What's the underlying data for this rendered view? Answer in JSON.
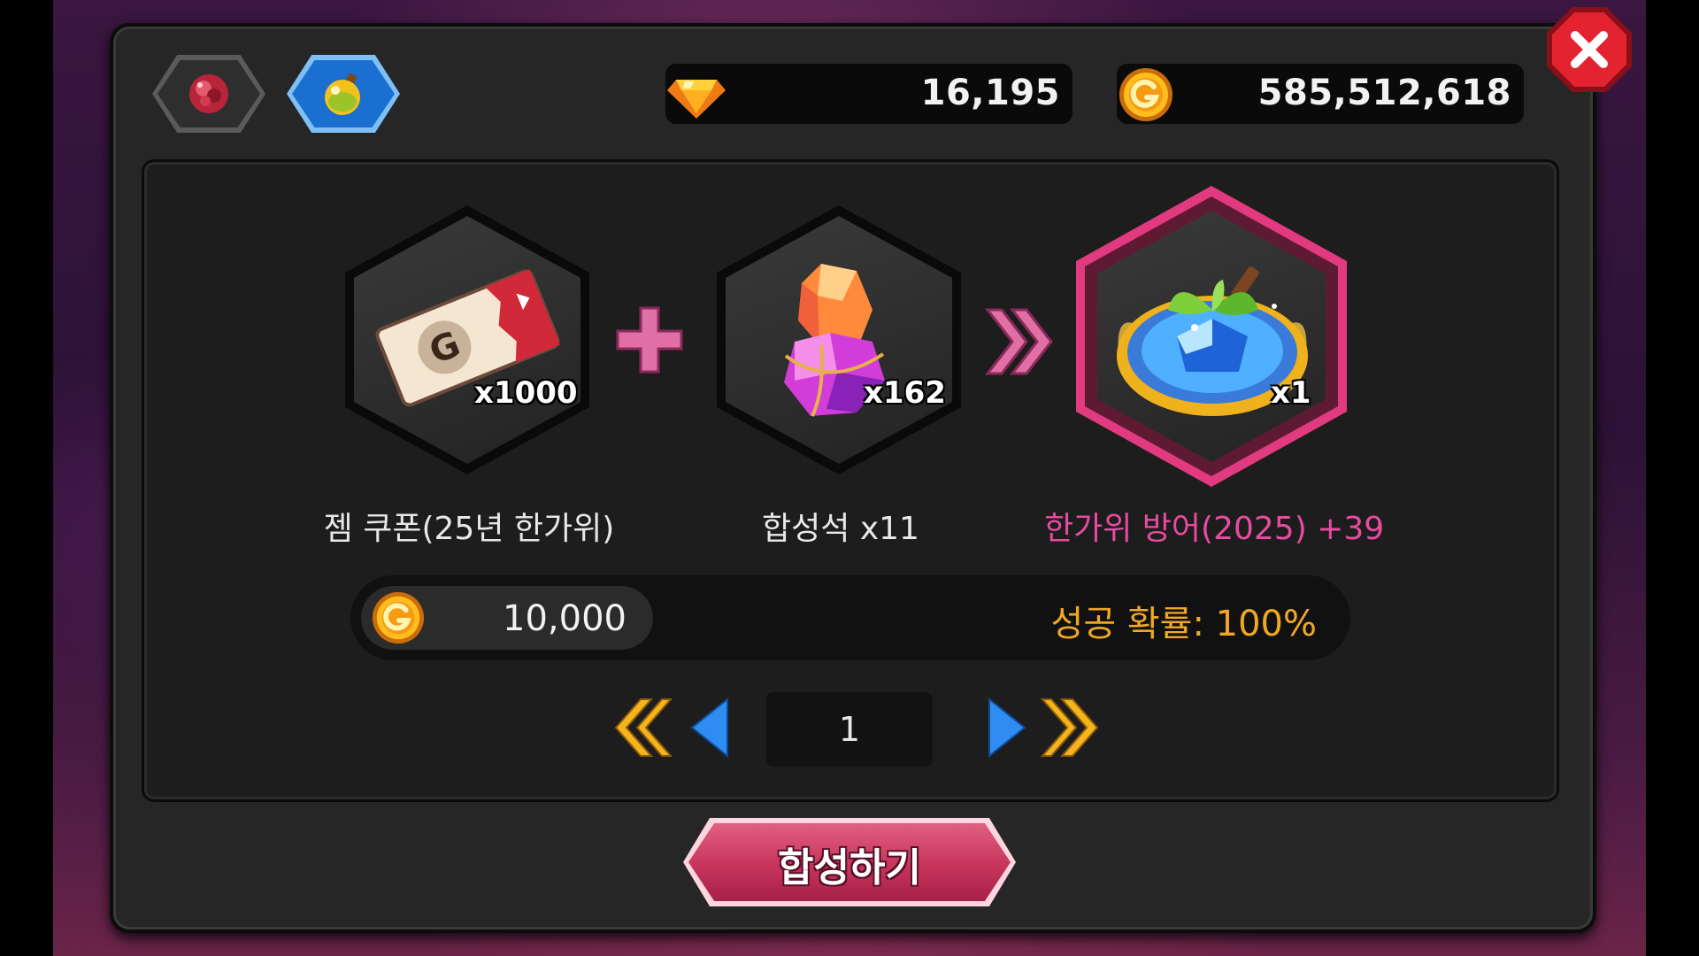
{
  "tabs": [
    {
      "label": "",
      "icon": "red-gem-icon",
      "active": false
    },
    {
      "label": "",
      "icon": "potion-orb-icon",
      "active": true
    }
  ],
  "currency": {
    "gems": "16,195",
    "gold": "585,512,618"
  },
  "recipe": {
    "ingredient1": {
      "qty": "x1000",
      "name": "젬 쿠폰(25년 한가위)",
      "icon": "gold-coupon-icon"
    },
    "ingredient2": {
      "qty": "x162",
      "name": "합성석 x11",
      "icon": "synthesis-stone-icon"
    },
    "result": {
      "qty": "x1",
      "name": "한가위 방어(2025) +39",
      "icon": "blue-gem-armor-icon"
    }
  },
  "cost": {
    "gold": "10,000",
    "success_rate": "성공 확률: 100%"
  },
  "pager": {
    "page": "1"
  },
  "synth_button": "합성하기",
  "colors": {
    "accent_pink": "#e84ba0",
    "success_orange": "#f0a824",
    "button_pink": "#c8345c",
    "close_red": "#e3232f"
  }
}
